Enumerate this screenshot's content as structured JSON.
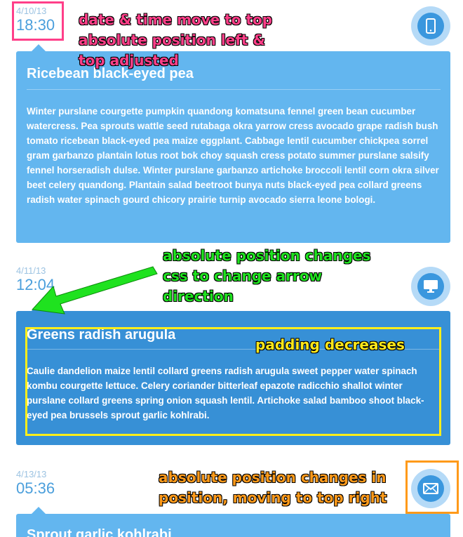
{
  "entries": [
    {
      "date": "4/10/13",
      "time": "18:30",
      "icon": "mobile-phone-icon",
      "title": "Ricebean black-eyed pea",
      "body": "Winter purslane courgette pumpkin quandong komatsuna fennel green bean cucumber watercress. Pea sprouts wattle seed rutabaga okra yarrow cress avocado grape radish bush tomato ricebean black-eyed pea maize eggplant. Cabbage lentil cucumber chickpea sorrel gram garbanzo plantain lotus root bok choy squash cress potato summer purslane salsify fennel horseradish dulse. Winter purslane garbanzo artichoke broccoli lentil corn okra silver beet celery quandong. Plantain salad beetroot bunya nuts black-eyed pea collard greens radish water spinach gourd chicory prairie turnip avocado sierra leone bologi."
    },
    {
      "date": "4/11/13",
      "time": "12:04",
      "icon": "desktop-monitor-icon",
      "title": "Greens radish arugula",
      "body": "Caulie dandelion maize lentil collard greens radish arugula sweet pepper water spinach kombu courgette lettuce. Celery coriander bitterleaf epazote radicchio shallot winter purslane collard greens spring onion squash lentil. Artichoke salad bamboo shoot black-eyed pea brussels sprout garlic kohlrabi."
    },
    {
      "date": "4/13/13",
      "time": "05:36",
      "icon": "envelope-icon",
      "title": "Sprout garlic kohlrabi",
      "body": ""
    }
  ],
  "annotations": {
    "pink": "date & time move to top absolute position left & top adjusted",
    "green": "absolute position changes css to change arrow direction",
    "yellow": "padding decreases",
    "orange": "absolute position changes in position, moving to top right"
  },
  "colors": {
    "card_light": "#63b6ef",
    "card_dark": "#3790d6",
    "icon_ring": "#b5daf7",
    "icon_core": "#3a97de",
    "time_text": "#4b9fdc",
    "annotation_pink": "#ff3f89",
    "annotation_green": "#1fe21f",
    "annotation_yellow": "#ffe81a",
    "annotation_orange": "#ff9a1a"
  }
}
